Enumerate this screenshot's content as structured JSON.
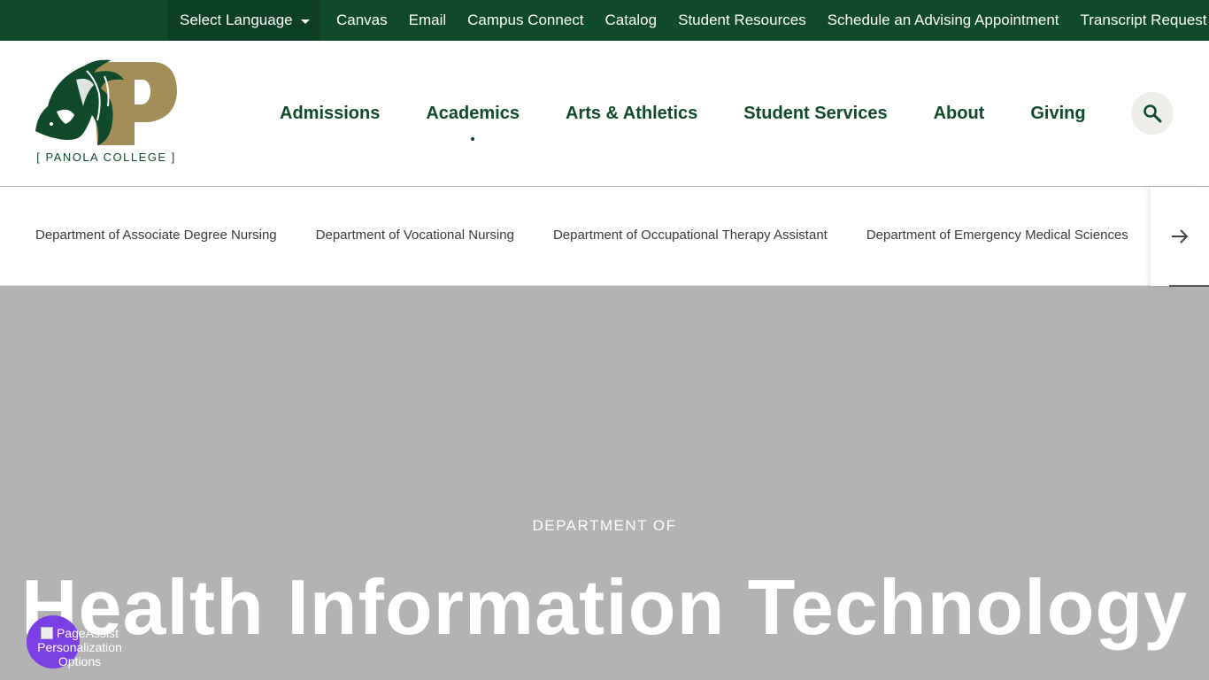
{
  "utility_bar": {
    "language_label": "Select Language",
    "links": [
      "Canvas",
      "Email",
      "Campus Connect",
      "Catalog",
      "Student Resources",
      "Schedule an Advising Appointment",
      "Transcript Request"
    ]
  },
  "logo": {
    "text": "[ PANOLA COLLEGE ]"
  },
  "main_nav": {
    "items": [
      "Admissions",
      "Academics",
      "Arts & Athletics",
      "Student Services",
      "About",
      "Giving"
    ],
    "active": "Academics"
  },
  "subnav": {
    "items": [
      "Department of Associate Degree Nursing",
      "Department of Vocational Nursing",
      "Department of Occupational Therapy Assistant",
      "Department of Emergency Medical Sciences"
    ]
  },
  "hero": {
    "eyebrow": "DEPARTMENT OF",
    "title": "Health Information Technology"
  },
  "page_assist": {
    "label": "PageAssist Personalization Options"
  },
  "icons": {
    "language": "chevron-down-icon",
    "search": "search-icon",
    "next": "arrow-right-icon"
  },
  "colors": {
    "brand_green": "#0f4a2a",
    "brand_gold": "#a38e57",
    "hero_bg": "#b3b3b3",
    "page_assist": "#7b3fe4"
  }
}
